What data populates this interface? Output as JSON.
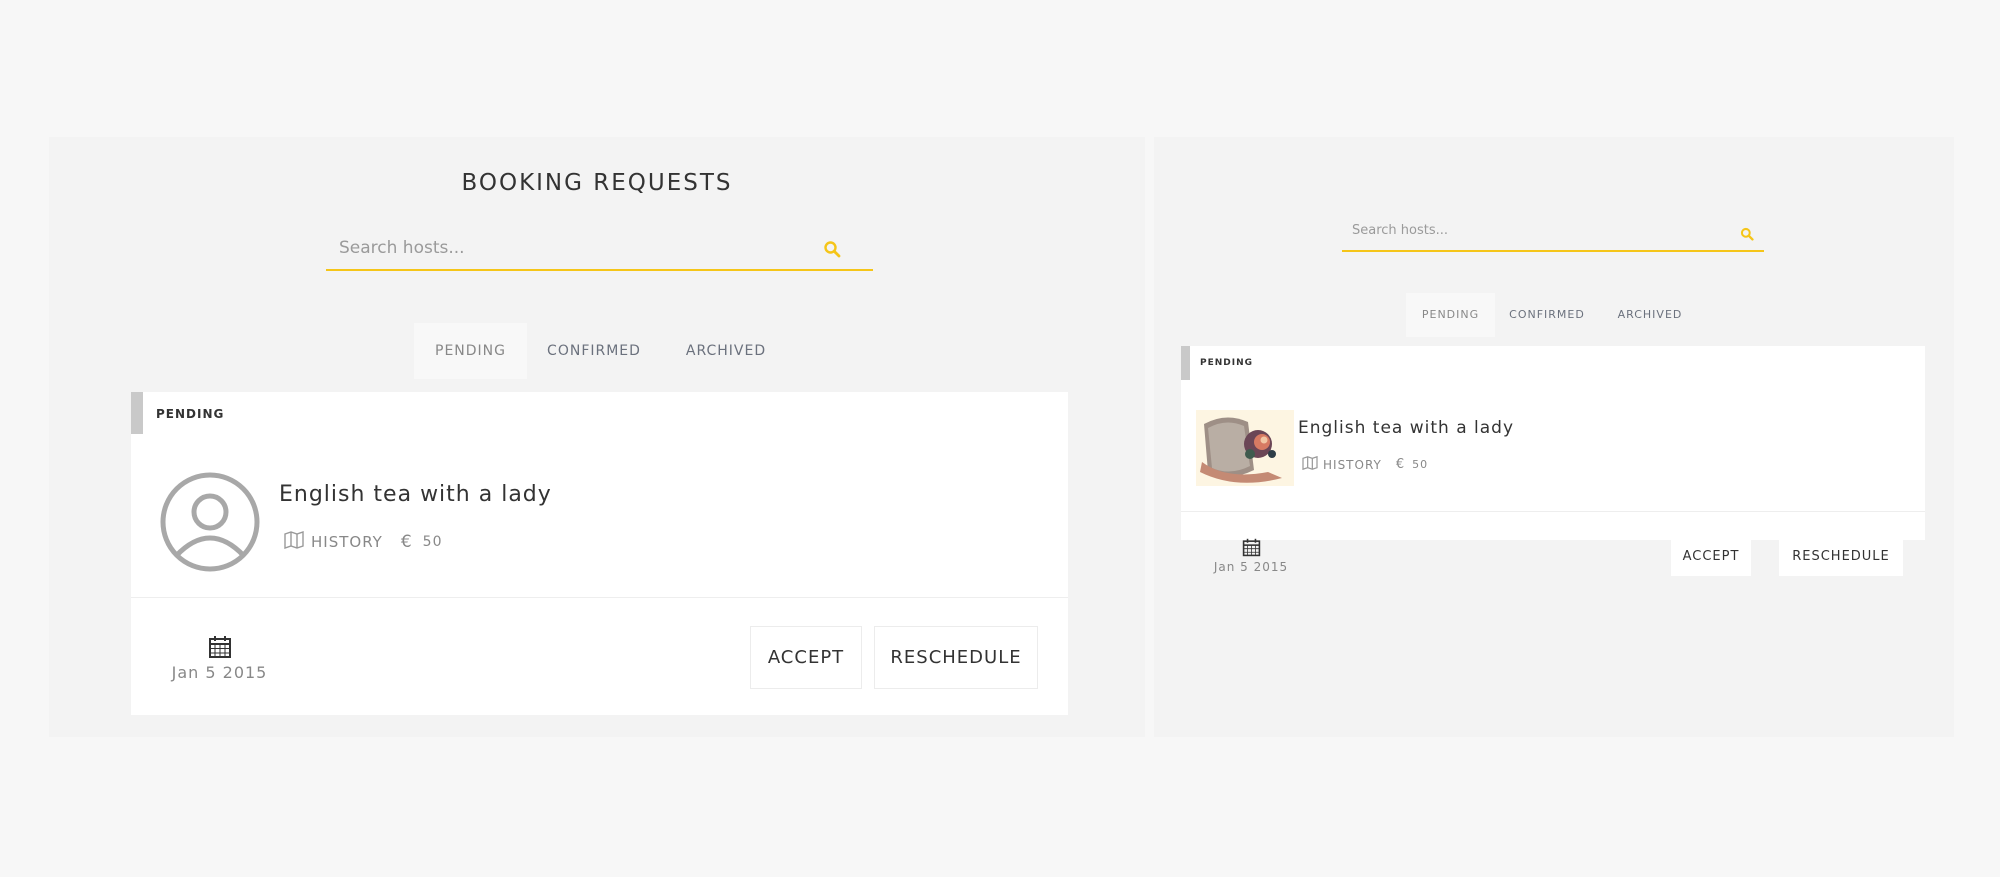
{
  "left": {
    "title": "BOOKING REQUESTS",
    "search": {
      "placeholder": "Search hosts...",
      "icon": "search-icon"
    },
    "tabs": [
      {
        "label": "PENDING",
        "active": true
      },
      {
        "label": "CONFIRMED",
        "active": false
      },
      {
        "label": "ARCHIVED",
        "active": false
      }
    ],
    "card": {
      "status": "PENDING",
      "title": "English tea with a lady",
      "category": "HISTORY",
      "currency": "€",
      "price": "50",
      "date": "Jan 5 2015",
      "accept_label": "ACCEPT",
      "reschedule_label": "RESCHEDULE"
    }
  },
  "right": {
    "search": {
      "placeholder": "Search hosts...",
      "icon": "search-icon"
    },
    "tabs": [
      {
        "label": "PENDING",
        "active": true
      },
      {
        "label": "CONFIRMED",
        "active": false
      },
      {
        "label": "ARCHIVED",
        "active": false
      }
    ],
    "card": {
      "status": "PENDING",
      "title": "English tea with a lady",
      "category": "HISTORY",
      "currency": "€",
      "price": "50",
      "date": "Jan 5 2015",
      "accept_label": "ACCEPT",
      "reschedule_label": "RESCHEDULE"
    }
  },
  "colors": {
    "accent": "#f5c518",
    "panel": "#f3f3f3",
    "card": "#ffffff",
    "status_bar": "#c9c9c9"
  }
}
